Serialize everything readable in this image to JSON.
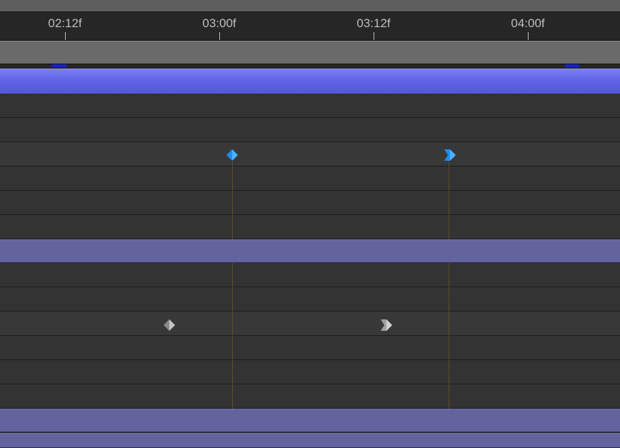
{
  "ruler": {
    "ticks": [
      {
        "label": "02:12f"
      },
      {
        "label": "03:00f"
      },
      {
        "label": "03:12f"
      },
      {
        "label": "04:00f"
      }
    ]
  },
  "colors": {
    "selected_layer_bar": "#5f63e6",
    "layer_bar": "#63639e",
    "work_area_handle": "#1a21c8",
    "keyframe_selected": "#1e8cf0",
    "keyframe_unselected": "#a0a0a0",
    "marker_line": "#5b5029"
  },
  "keyframes": {
    "selected_property": [
      {
        "time": "03:00f",
        "shape": "linear-diamond-icon"
      },
      {
        "time": "03:19f",
        "shape": "ease-in-keyframe-icon"
      }
    ],
    "unselected_property": [
      {
        "time": "02:24f",
        "shape": "linear-diamond-icon"
      },
      {
        "time": "03:14f",
        "shape": "ease-in-keyframe-icon"
      }
    ]
  }
}
